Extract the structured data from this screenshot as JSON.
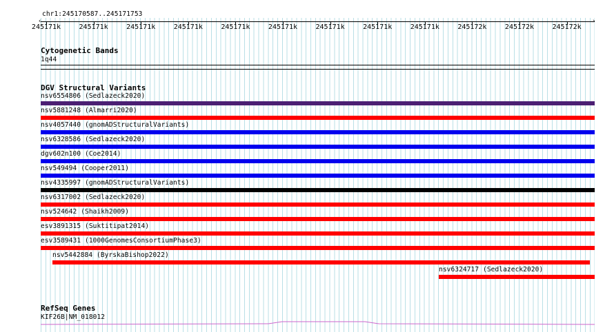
{
  "ruler": {
    "coords": "chr1:245170587..245171753",
    "ticks": [
      "245171k",
      "245171k",
      "245171k",
      "245171k",
      "245171k",
      "245171k",
      "245171k",
      "245171k",
      "245171k",
      "245172k",
      "245172k",
      "245172k"
    ]
  },
  "cyto": {
    "title": "Cytogenetic Bands",
    "band": "1q44"
  },
  "dgv": {
    "title": "DGV Structural Variants",
    "features": [
      {
        "label": "nsv6554806 (Sedlazeck2020)",
        "color": "#4b1f73"
      },
      {
        "label": "nsv5881248 (Almarri2020)",
        "color": "#ff0000"
      },
      {
        "label": "nsv4057440 (gnomADStructuralVariants)",
        "color": "#0000ee"
      },
      {
        "label": "nsv6328586 (Sedlazeck2020)",
        "color": "#0000ee"
      },
      {
        "label": "dgv602n100 (Coe2014)",
        "color": "#0000ee"
      },
      {
        "label": "nsv549494 (Cooper2011)",
        "color": "#0000ee"
      },
      {
        "label": "nsv4335997 (gnomADStructuralVariants)",
        "color": "#000000"
      },
      {
        "label": "nsv6317002 (Sedlazeck2020)",
        "color": "#ff0000"
      },
      {
        "label": "nsv524642 (Shaikh2009)",
        "color": "#ff0000"
      },
      {
        "label": "esv3891315 (Suktitipat2014)",
        "color": "#ff0000"
      },
      {
        "label": "esv3589431 (1000GenomesConsortiumPhase3)",
        "color": "#ff0000"
      },
      {
        "label": "nsv5442884 (ByrskaBishop2022)",
        "color": "#ff0000"
      },
      {
        "label": "nsv6324717 (Sedlazeck2020)",
        "color": "#ff0000"
      }
    ]
  },
  "refseq": {
    "title": "RefSeq Genes",
    "gene": "KIF26B|NM_018012",
    "color": "#cc66cc"
  }
}
